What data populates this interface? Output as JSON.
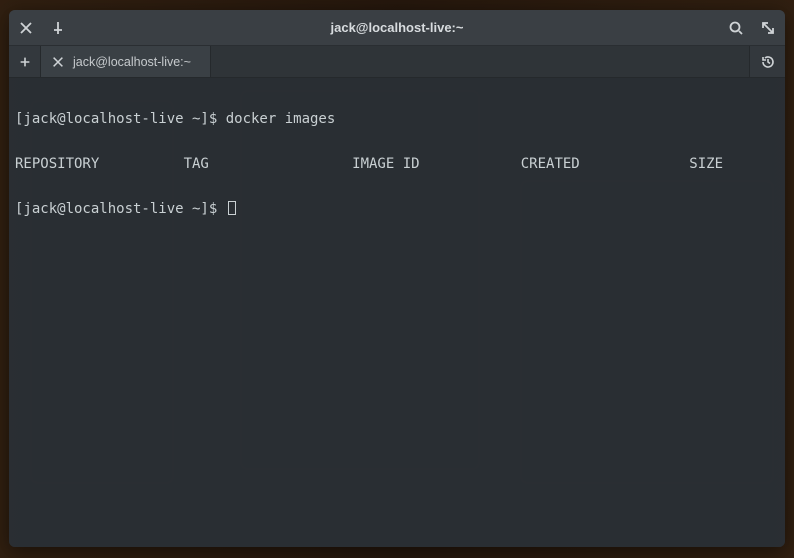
{
  "window": {
    "title": "jack@localhost-live:~"
  },
  "tabs": {
    "items": [
      {
        "label": "jack@localhost-live:~"
      }
    ]
  },
  "terminal": {
    "prompt": "[jack@localhost-live ~]$ ",
    "lines": [
      "[jack@localhost-live ~]$ docker images",
      "REPOSITORY          TAG                 IMAGE ID            CREATED             SIZE"
    ],
    "columns": [
      "REPOSITORY",
      "TAG",
      "IMAGE ID",
      "CREATED",
      "SIZE"
    ]
  },
  "icons": {
    "close": "close-icon",
    "pin": "pin-icon",
    "search": "search-icon",
    "fullscreen": "fullscreen-icon",
    "new_tab": "plus-icon",
    "tab_close": "close-icon",
    "history": "history-icon"
  }
}
